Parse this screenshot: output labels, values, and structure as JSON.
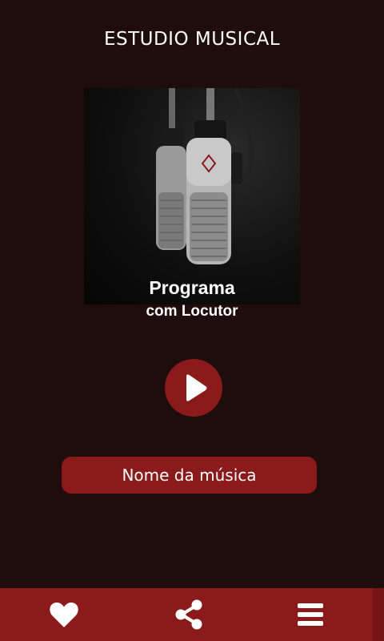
{
  "header": {
    "title": "ESTUDIO MUSICAL"
  },
  "program": {
    "title": "Programa",
    "subtitle": "com Locutor"
  },
  "player": {
    "play_icon": "play-icon"
  },
  "song": {
    "name": "Nome da música"
  },
  "bottom_nav": {
    "items": [
      {
        "icon": "heart-icon"
      },
      {
        "icon": "share-icon"
      },
      {
        "icon": "menu-icon"
      }
    ]
  },
  "colors": {
    "background": "#1f0d0e",
    "accent": "#8b1a1a",
    "text": "#ffffff"
  }
}
